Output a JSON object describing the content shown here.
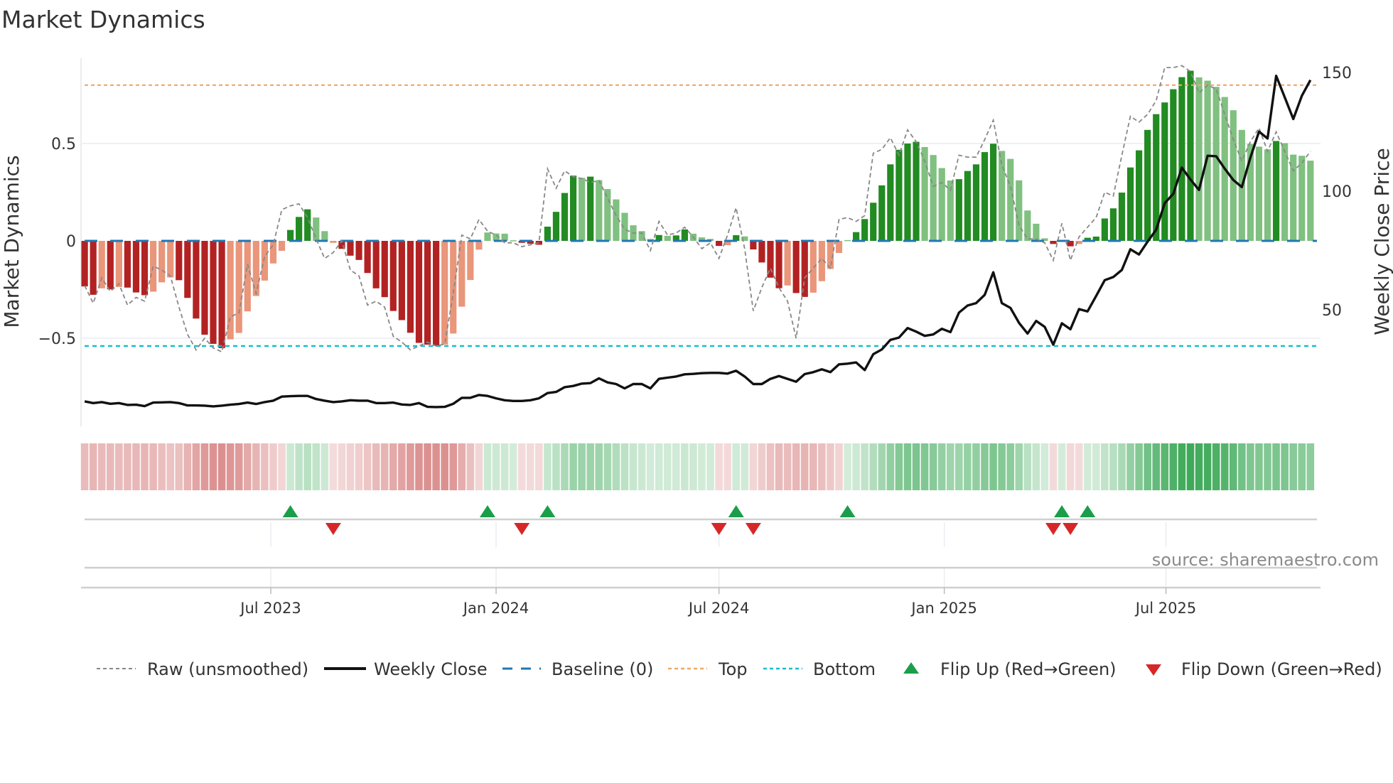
{
  "chart_data": {
    "type": "bar",
    "title": "Market Dynamics",
    "ylabel": "Market Dynamics",
    "y2label": "Weekly Close Price",
    "ylim": [
      -0.95,
      0.95
    ],
    "y2lim": [
      -12,
      157
    ],
    "yticks": [
      {
        "value": 0.5,
        "label": "0.5"
      },
      {
        "value": 0,
        "label": "0"
      },
      {
        "value": -0.5,
        "label": "−0.5"
      }
    ],
    "y2ticks": [
      {
        "value": 150,
        "label": "150"
      },
      {
        "value": 100,
        "label": "100"
      },
      {
        "value": 50,
        "label": "50"
      }
    ],
    "xticks": [
      {
        "date": "2023-07-01",
        "label": "Jul 2023"
      },
      {
        "date": "2024-01-01",
        "label": "Jan 2024"
      },
      {
        "date": "2024-07-01",
        "label": "Jul 2024"
      },
      {
        "date": "2025-01-01",
        "label": "Jan 2025"
      },
      {
        "date": "2025-07-01",
        "label": "Jul 2025"
      }
    ],
    "first_week": "2023-01-30",
    "frequency": "weekly",
    "top_level": 0.8,
    "bottom_level": -0.54,
    "baseline": 0,
    "series": [
      {
        "name": "Market Dynamics (smoothed)",
        "type": "bar",
        "values": [
          -0.234,
          -0.277,
          -0.244,
          -0.249,
          -0.237,
          -0.24,
          -0.265,
          -0.279,
          -0.261,
          -0.213,
          -0.188,
          -0.202,
          -0.293,
          -0.399,
          -0.482,
          -0.529,
          -0.551,
          -0.506,
          -0.473,
          -0.362,
          -0.283,
          -0.204,
          -0.116,
          -0.051,
          0.056,
          0.123,
          0.162,
          0.12,
          0.05,
          -0.01,
          -0.041,
          -0.076,
          -0.098,
          -0.165,
          -0.244,
          -0.289,
          -0.36,
          -0.407,
          -0.472,
          -0.524,
          -0.533,
          -0.539,
          -0.533,
          -0.476,
          -0.338,
          -0.201,
          -0.045,
          0.043,
          0.038,
          0.037,
          0.003,
          -0.01,
          -0.015,
          -0.02,
          0.073,
          0.149,
          0.246,
          0.335,
          0.324,
          0.33,
          0.312,
          0.266,
          0.213,
          0.144,
          0.08,
          0.05,
          0.01,
          0.03,
          0.026,
          0.028,
          0.059,
          0.037,
          0.018,
          0.01,
          -0.026,
          -0.022,
          0.029,
          0.023,
          -0.044,
          -0.111,
          -0.189,
          -0.243,
          -0.229,
          -0.268,
          -0.288,
          -0.266,
          -0.207,
          -0.144,
          -0.062,
          0.004,
          0.045,
          0.112,
          0.196,
          0.285,
          0.393,
          0.468,
          0.5,
          0.509,
          0.482,
          0.441,
          0.374,
          0.31,
          0.317,
          0.359,
          0.393,
          0.456,
          0.499,
          0.462,
          0.421,
          0.311,
          0.156,
          0.088,
          0.013,
          -0.016,
          0.004,
          -0.028,
          -0.016,
          0.016,
          0.022,
          0.115,
          0.167,
          0.248,
          0.377,
          0.465,
          0.57,
          0.651,
          0.711,
          0.779,
          0.841,
          0.874,
          0.84,
          0.823,
          0.791,
          0.739,
          0.671,
          0.57,
          0.498,
          0.484,
          0.47,
          0.513,
          0.502,
          0.443,
          0.437,
          0.412
        ]
      },
      {
        "name": "Raw (unsmoothed)",
        "type": "line",
        "values": [
          -0.23,
          -0.32,
          -0.19,
          -0.26,
          -0.22,
          -0.33,
          -0.29,
          -0.31,
          -0.13,
          -0.15,
          -0.18,
          -0.34,
          -0.48,
          -0.56,
          -0.5,
          -0.55,
          -0.57,
          -0.39,
          -0.37,
          -0.12,
          -0.27,
          -0.08,
          -0.02,
          0.16,
          0.18,
          0.19,
          0.12,
          0.01,
          -0.09,
          -0.06,
          0.0,
          -0.15,
          -0.18,
          -0.33,
          -0.31,
          -0.34,
          -0.49,
          -0.52,
          -0.56,
          -0.54,
          -0.52,
          -0.54,
          -0.53,
          -0.27,
          0.03,
          0.01,
          0.11,
          0.05,
          0.03,
          -0.01,
          -0.01,
          -0.03,
          -0.02,
          -0.01,
          0.37,
          0.27,
          0.36,
          0.33,
          0.32,
          0.3,
          0.31,
          0.22,
          0.13,
          0.06,
          0.04,
          0.04,
          -0.05,
          0.1,
          0.03,
          0.04,
          0.07,
          0.02,
          -0.04,
          -0.01,
          -0.09,
          0.03,
          0.17,
          -0.04,
          -0.36,
          -0.24,
          -0.14,
          -0.24,
          -0.31,
          -0.5,
          -0.19,
          -0.14,
          -0.09,
          -0.14,
          0.11,
          0.12,
          0.1,
          0.13,
          0.45,
          0.47,
          0.53,
          0.44,
          0.57,
          0.51,
          0.41,
          0.28,
          0.3,
          0.26,
          0.44,
          0.43,
          0.43,
          0.52,
          0.62,
          0.39,
          0.28,
          0.08,
          0.01,
          0.01,
          -0.01,
          -0.1,
          0.09,
          -0.1,
          0.02,
          0.07,
          0.12,
          0.25,
          0.23,
          0.44,
          0.64,
          0.61,
          0.65,
          0.72,
          0.89,
          0.89,
          0.9,
          0.87,
          0.76,
          0.8,
          0.78,
          0.65,
          0.52,
          0.41,
          0.51,
          0.58,
          0.46,
          0.56,
          0.46,
          0.36,
          0.4,
          0.46
        ]
      },
      {
        "name": "Weekly Close",
        "type": "line",
        "axis": "right",
        "values": [
          11.4,
          10.7,
          11.1,
          10.4,
          10.7,
          9.9,
          10.0,
          9.4,
          10.9,
          11.0,
          11.1,
          10.7,
          9.7,
          9.7,
          9.6,
          9.3,
          9.6,
          10.0,
          10.3,
          10.9,
          10.3,
          11.1,
          11.7,
          13.4,
          13.6,
          13.7,
          13.7,
          12.4,
          11.7,
          11.1,
          11.4,
          11.9,
          11.7,
          11.7,
          10.7,
          10.7,
          10.9,
          10.1,
          9.9,
          10.7,
          9.1,
          9.0,
          9.1,
          10.4,
          12.9,
          12.9,
          14.1,
          13.7,
          12.7,
          11.9,
          11.6,
          11.6,
          11.9,
          12.7,
          14.9,
          15.4,
          17.4,
          17.9,
          18.9,
          19.1,
          21.1,
          19.4,
          18.7,
          16.9,
          18.7,
          18.7,
          16.9,
          20.9,
          21.4,
          21.9,
          22.8,
          23.0,
          23.3,
          23.4,
          23.4,
          23.1,
          24.3,
          21.9,
          18.7,
          18.7,
          20.9,
          22.1,
          20.9,
          19.7,
          22.9,
          23.7,
          24.9,
          23.7,
          27.0,
          27.3,
          27.8,
          24.6,
          31.3,
          33.3,
          37.3,
          38.3,
          42.3,
          40.8,
          39.0,
          39.6,
          42.0,
          40.6,
          48.8,
          51.8,
          52.8,
          56.3,
          65.8,
          52.8,
          50.8,
          44.5,
          40.0,
          45.3,
          42.8,
          35.3,
          44.3,
          41.8,
          50.3,
          49.3,
          55.8,
          62.5,
          63.8,
          66.8,
          75.5,
          73.3,
          78.7,
          83.7,
          94.9,
          98.9,
          109.9,
          104.9,
          100.5,
          114.9,
          114.7,
          109.5,
          104.7,
          101.7,
          114.2,
          125.1,
          122.2,
          148.6,
          139.6,
          130.4,
          140.2,
          146.8
        ]
      }
    ],
    "legend": {
      "placement": "bottom",
      "items": [
        {
          "key": "raw",
          "label": "Raw (unsmoothed)"
        },
        {
          "key": "close",
          "label": "Weekly Close"
        },
        {
          "key": "baseline",
          "label": "Baseline (0)"
        },
        {
          "key": "top",
          "label": "Top"
        },
        {
          "key": "bottom",
          "label": "Bottom"
        },
        {
          "key": "flip_up",
          "label": "Flip Up (Red→Green)"
        },
        {
          "key": "flip_down",
          "label": "Flip Down (Green→Red)"
        }
      ]
    },
    "source": "source: sharemaestro.com",
    "colors": {
      "neg_strong": "#b22222",
      "neg_weak": "#e9967a",
      "pos_strong": "#228b22",
      "pos_weak": "#80c080",
      "raw": "#888888",
      "close": "#111111",
      "baseline": "#1f77b4",
      "top": "#f0a868",
      "bottom": "#17becf",
      "flip_up": "#1a9e4a",
      "flip_down": "#d62728"
    }
  }
}
